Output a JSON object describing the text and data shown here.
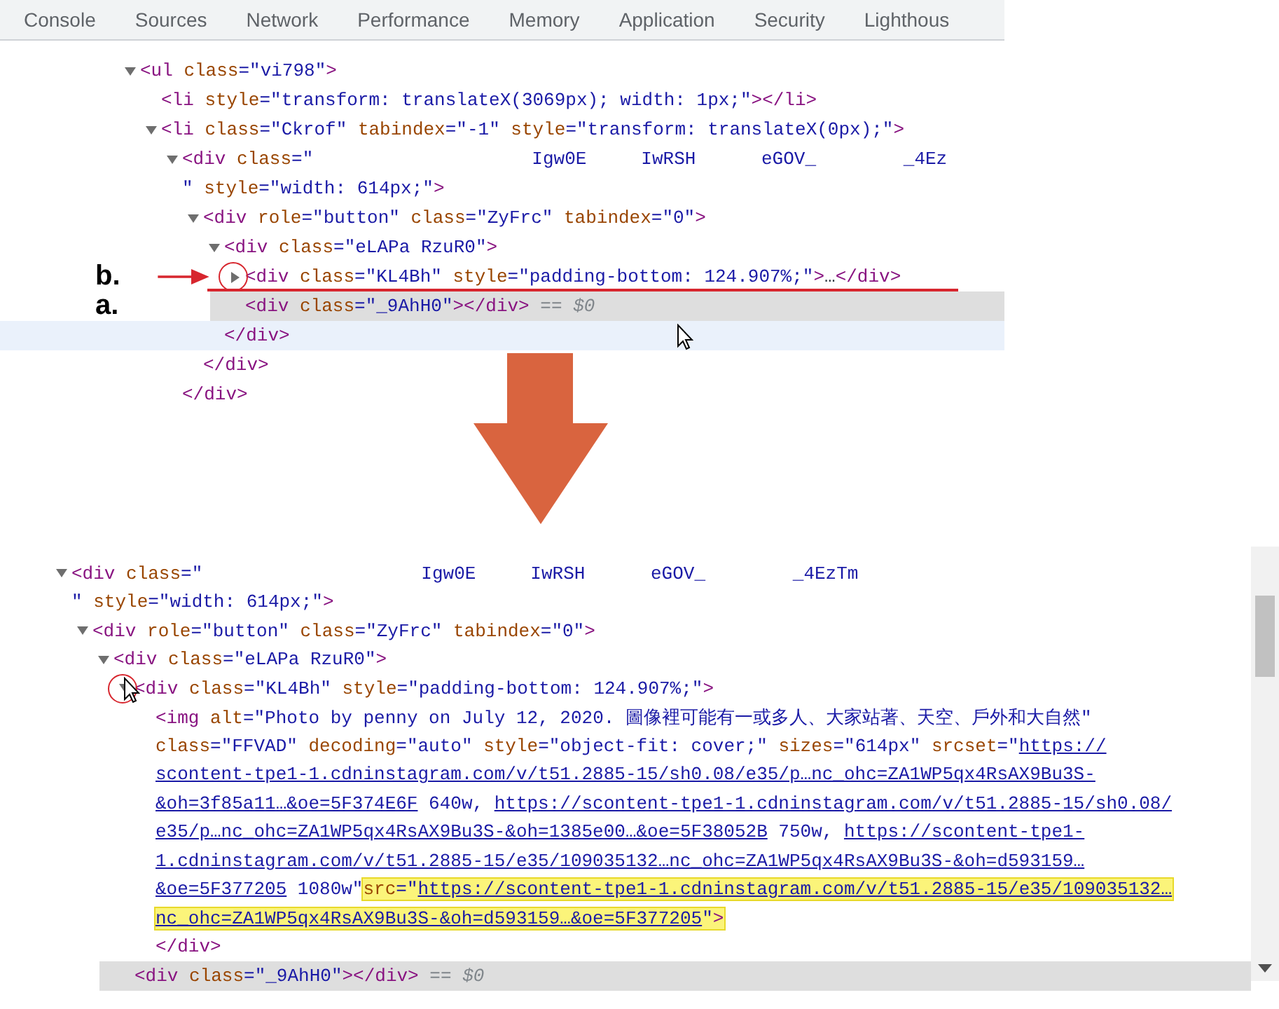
{
  "panels": [
    {
      "tabs": [
        {
          "label": "Console",
          "selected": false
        },
        {
          "label": "Sources",
          "selected": false
        },
        {
          "label": "Network",
          "selected": false
        },
        {
          "label": "Performance",
          "selected": false
        },
        {
          "label": "Memory",
          "selected": false
        },
        {
          "label": "Application",
          "selected": false
        },
        {
          "label": "Security",
          "selected": false
        },
        {
          "label": "Lighthous",
          "selected": false
        }
      ],
      "tree": [
        {
          "kind": "branch",
          "expanded": true,
          "selected": false,
          "hovered": false,
          "lines": [
            {
              "tokens": [
                {
                  "kind": "tag",
                  "text": "<ul"
                },
                {
                  "kind": "attr",
                  "text": " class"
                },
                {
                  "kind": "value",
                  "text": "=\"vi798\""
                },
                {
                  "kind": "tag",
                  "text": ">"
                }
              ]
            }
          ],
          "children": [
            {
              "kind": "leaf",
              "selected": false,
              "hovered": false,
              "lines": [
                {
                  "tokens": [
                    {
                      "kind": "tag",
                      "text": "<li"
                    },
                    {
                      "kind": "attr",
                      "text": " style"
                    },
                    {
                      "kind": "value",
                      "text": "=\"transform: translateX(3069px); width: 1px;\""
                    },
                    {
                      "kind": "tag",
                      "text": "></li>"
                    }
                  ]
                }
              ]
            },
            {
              "kind": "branch",
              "expanded": true,
              "selected": false,
              "hovered": false,
              "lines": [
                {
                  "tokens": [
                    {
                      "kind": "tag",
                      "text": "<li"
                    },
                    {
                      "kind": "attr",
                      "text": " class"
                    },
                    {
                      "kind": "value",
                      "text": "=\"Ckrof\""
                    },
                    {
                      "kind": "attr",
                      "text": " tabindex"
                    },
                    {
                      "kind": "value",
                      "text": "=\"-1\""
                    },
                    {
                      "kind": "attr",
                      "text": " style"
                    },
                    {
                      "kind": "value",
                      "text": "=\"transform: translateX(0px);\""
                    },
                    {
                      "kind": "tag",
                      "text": ">"
                    }
                  ]
                }
              ],
              "children": [
                {
                  "kind": "branch",
                  "expanded": true,
                  "selected": false,
                  "hovered": false,
                  "lines": [
                    {
                      "tokens": [
                        {
                          "kind": "tag",
                          "text": "<div"
                        },
                        {
                          "kind": "attr",
                          "text": " class"
                        },
                        {
                          "kind": "value",
                          "text": "=\"                    Igw0E     IwRSH      eGOV_        _4Ez"
                        }
                      ]
                    },
                    {
                      "tokens": [
                        {
                          "kind": "value",
                          "text": "\""
                        },
                        {
                          "kind": "attr",
                          "text": " style"
                        },
                        {
                          "kind": "value",
                          "text": "=\"width: 614px;\""
                        },
                        {
                          "kind": "tag",
                          "text": ">"
                        }
                      ]
                    }
                  ],
                  "children": [
                    {
                      "kind": "branch",
                      "expanded": true,
                      "selected": false,
                      "hovered": false,
                      "lines": [
                        {
                          "tokens": [
                            {
                              "kind": "tag",
                              "text": "<div"
                            },
                            {
                              "kind": "attr",
                              "text": " role"
                            },
                            {
                              "kind": "value",
                              "text": "=\"button\""
                            },
                            {
                              "kind": "attr",
                              "text": " class"
                            },
                            {
                              "kind": "value",
                              "text": "=\"ZyFrc\""
                            },
                            {
                              "kind": "attr",
                              "text": " tabindex"
                            },
                            {
                              "kind": "value",
                              "text": "=\"0\""
                            },
                            {
                              "kind": "tag",
                              "text": ">"
                            }
                          ]
                        }
                      ],
                      "children": [
                        {
                          "kind": "branch",
                          "expanded": true,
                          "selected": false,
                          "hovered": false,
                          "lines": [
                            {
                              "tokens": [
                                {
                                  "kind": "tag",
                                  "text": "<div"
                                },
                                {
                                  "kind": "attr",
                                  "text": " class"
                                },
                                {
                                  "kind": "value",
                                  "text": "=\"eLAPa RzuR0\""
                                },
                                {
                                  "kind": "tag",
                                  "text": ">"
                                }
                              ]
                            }
                          ],
                          "children": [
                            {
                              "kind": "branch",
                              "expanded": false,
                              "selected": false,
                              "hovered": false,
                              "annotation": {
                                "label": "b.",
                                "arrow": true,
                                "circled": true,
                                "underlined": true
                              },
                              "lines": [
                                {
                                  "tokens": [
                                    {
                                      "kind": "tag",
                                      "text": "<div"
                                    },
                                    {
                                      "kind": "attr",
                                      "text": " class"
                                    },
                                    {
                                      "kind": "value",
                                      "text": "=\"KL4Bh\""
                                    },
                                    {
                                      "kind": "attr",
                                      "text": " style"
                                    },
                                    {
                                      "kind": "value",
                                      "text": "=\"padding-bottom: 124.907%;\""
                                    },
                                    {
                                      "kind": "tag",
                                      "text": ">"
                                    },
                                    {
                                      "kind": "plain",
                                      "text": "…"
                                    },
                                    {
                                      "kind": "tag",
                                      "text": "</div>"
                                    }
                                  ]
                                }
                              ]
                            },
                            {
                              "kind": "leaf",
                              "selected": true,
                              "hovered": false,
                              "annotation": {
                                "label": "a."
                              },
                              "lines": [
                                {
                                  "tokens": [
                                    {
                                      "kind": "tag",
                                      "text": "<div"
                                    },
                                    {
                                      "kind": "attr",
                                      "text": " class"
                                    },
                                    {
                                      "kind": "value",
                                      "text": "=\"_9AhH0\""
                                    },
                                    {
                                      "kind": "tag",
                                      "text": "></div>"
                                    },
                                    {
                                      "kind": "dim",
                                      "text": " == *$0*"
                                    }
                                  ]
                                }
                              ]
                            }
                          ]
                        },
                        {
                          "kind": "leaf",
                          "selected": false,
                          "hovered": true,
                          "pointer": true,
                          "lines": [
                            {
                              "tokens": [
                                {
                                  "kind": "tag",
                                  "text": "</div>"
                                }
                              ]
                            }
                          ]
                        }
                      ]
                    },
                    {
                      "kind": "leaf",
                      "selected": false,
                      "hovered": false,
                      "lines": [
                        {
                          "tokens": [
                            {
                              "kind": "tag",
                              "text": "</div>"
                            }
                          ]
                        }
                      ]
                    }
                  ]
                },
                {
                  "kind": "leaf",
                  "selected": false,
                  "hovered": false,
                  "lines": [
                    {
                      "tokens": [
                        {
                          "kind": "tag",
                          "text": "</div>"
                        }
                      ]
                    }
                  ]
                }
              ]
            }
          ]
        }
      ]
    },
    {
      "tree": [
        {
          "kind": "branch",
          "expanded": true,
          "selected": false,
          "hovered": false,
          "lines": [
            {
              "tokens": [
                {
                  "kind": "tag",
                  "text": "<div"
                },
                {
                  "kind": "attr",
                  "text": " class"
                },
                {
                  "kind": "value",
                  "text": "=\"                    Igw0E     IwRSH      eGOV_        _4EzTm"
                }
              ]
            },
            {
              "tokens": [
                {
                  "kind": "value",
                  "text": "\""
                },
                {
                  "kind": "attr",
                  "text": " style"
                },
                {
                  "kind": "value",
                  "text": "=\"width: 614px;\""
                },
                {
                  "kind": "tag",
                  "text": ">"
                }
              ]
            }
          ],
          "children": [
            {
              "kind": "branch",
              "expanded": true,
              "selected": false,
              "hovered": false,
              "lines": [
                {
                  "tokens": [
                    {
                      "kind": "tag",
                      "text": "<div"
                    },
                    {
                      "kind": "attr",
                      "text": " role"
                    },
                    {
                      "kind": "value",
                      "text": "=\"button\""
                    },
                    {
                      "kind": "attr",
                      "text": " class"
                    },
                    {
                      "kind": "value",
                      "text": "=\"ZyFrc\""
                    },
                    {
                      "kind": "attr",
                      "text": " tabindex"
                    },
                    {
                      "kind": "value",
                      "text": "=\"0\""
                    },
                    {
                      "kind": "tag",
                      "text": ">"
                    }
                  ]
                }
              ],
              "children": [
                {
                  "kind": "branch",
                  "expanded": true,
                  "selected": false,
                  "hovered": false,
                  "lines": [
                    {
                      "tokens": [
                        {
                          "kind": "tag",
                          "text": "<div"
                        },
                        {
                          "kind": "attr",
                          "text": " class"
                        },
                        {
                          "kind": "value",
                          "text": "=\"eLAPa RzuR0\""
                        },
                        {
                          "kind": "tag",
                          "text": ">"
                        }
                      ]
                    }
                  ],
                  "children": [
                    {
                      "kind": "branch",
                      "expanded": true,
                      "selected": false,
                      "hovered": false,
                      "pointer": true,
                      "annotation": {
                        "circled": true
                      },
                      "lines": [
                        {
                          "tokens": [
                            {
                              "kind": "tag",
                              "text": "<div"
                            },
                            {
                              "kind": "attr",
                              "text": " class"
                            },
                            {
                              "kind": "value",
                              "text": "=\"KL4Bh\""
                            },
                            {
                              "kind": "attr",
                              "text": " style"
                            },
                            {
                              "kind": "value",
                              "text": "=\"padding-bottom: 124.907%;\""
                            },
                            {
                              "kind": "tag",
                              "text": ">"
                            }
                          ]
                        }
                      ],
                      "children": [
                        {
                          "kind": "leaf",
                          "selected": false,
                          "hovered": false,
                          "lines": [
                            {
                              "tokens": [
                                {
                                  "kind": "tag",
                                  "text": "<img"
                                },
                                {
                                  "kind": "attr",
                                  "text": " alt"
                                },
                                {
                                  "kind": "value",
                                  "text": "=\"Photo by penny on July 12, 2020. 圖像裡可能有一或多人、大家站著、天空、戶外和大自然\""
                                }
                              ]
                            },
                            {
                              "tokens": [
                                {
                                  "kind": "attr",
                                  "text": "class"
                                },
                                {
                                  "kind": "value",
                                  "text": "=\"FFVAD\""
                                },
                                {
                                  "kind": "attr",
                                  "text": " decoding"
                                },
                                {
                                  "kind": "value",
                                  "text": "=\"auto\""
                                },
                                {
                                  "kind": "attr",
                                  "text": " style"
                                },
                                {
                                  "kind": "value",
                                  "text": "=\"object-fit: cover;\""
                                },
                                {
                                  "kind": "attr",
                                  "text": " sizes"
                                },
                                {
                                  "kind": "value",
                                  "text": "=\"614px\""
                                },
                                {
                                  "kind": "attr",
                                  "text": " srcset"
                                },
                                {
                                  "kind": "value",
                                  "text": "=\""
                                },
                                {
                                  "kind": "link",
                                  "text": "https://"
                                }
                              ]
                            },
                            {
                              "tokens": [
                                {
                                  "kind": "link",
                                  "text": "scontent-tpe1-1.cdninstagram.com/v/t51.2885-15/sh0.08/e35/p…nc_ohc=ZA1WP5qx4RsAX9Bu3S-"
                                }
                              ]
                            },
                            {
                              "tokens": [
                                {
                                  "kind": "link",
                                  "text": "&oh=3f85a11…&oe=5F374E6F"
                                },
                                {
                                  "kind": "value",
                                  "text": " 640w, "
                                },
                                {
                                  "kind": "link",
                                  "text": "https://scontent-tpe1-1.cdninstagram.com/v/t51.2885-15/sh0.08/"
                                }
                              ]
                            },
                            {
                              "tokens": [
                                {
                                  "kind": "link",
                                  "text": "e35/p…nc_ohc=ZA1WP5qx4RsAX9Bu3S-&oh=1385e00…&oe=5F38052B"
                                },
                                {
                                  "kind": "value",
                                  "text": " 750w, "
                                },
                                {
                                  "kind": "link",
                                  "text": "https://scontent-tpe1-"
                                }
                              ]
                            },
                            {
                              "tokens": [
                                {
                                  "kind": "link",
                                  "text": "1.cdninstagram.com/v/t51.2885-15/e35/109035132…nc_ohc=ZA1WP5qx4RsAX9Bu3S-&oh=d593159…"
                                }
                              ]
                            },
                            {
                              "tokens": [
                                {
                                  "kind": "link",
                                  "text": "&oe=5F377205"
                                },
                                {
                                  "kind": "value",
                                  "text": " 1080w\""
                                }
                              ],
                              "highlighted": [
                                {
                                  "kind": "attr",
                                  "text": "src"
                                },
                                {
                                  "kind": "value",
                                  "text": "=\""
                                },
                                {
                                  "kind": "link",
                                  "text": "https://scontent-tpe1-1.cdninstagram.com/v/t51.2885-15/e35/109035132…"
                                }
                              ]
                            },
                            {
                              "highlighted": [
                                {
                                  "kind": "link",
                                  "text": "nc_ohc=ZA1WP5qx4RsAX9Bu3S-&oh=d593159…&oe=5F377205"
                                },
                                {
                                  "kind": "value",
                                  "text": "\""
                                },
                                {
                                  "kind": "tag",
                                  "text": ">"
                                }
                              ]
                            }
                          ]
                        },
                        {
                          "kind": "leaf",
                          "selected": false,
                          "hovered": false,
                          "lines": [
                            {
                              "tokens": [
                                {
                                  "kind": "tag",
                                  "text": "</div>"
                                }
                              ]
                            }
                          ]
                        }
                      ]
                    },
                    {
                      "kind": "leaf",
                      "selected": true,
                      "hovered": false,
                      "lines": [
                        {
                          "tokens": [
                            {
                              "kind": "tag",
                              "text": "<div"
                            },
                            {
                              "kind": "attr",
                              "text": " class"
                            },
                            {
                              "kind": "value",
                              "text": "=\"_9AhH0\""
                            },
                            {
                              "kind": "tag",
                              "text": "></div>"
                            },
                            {
                              "kind": "dim",
                              "text": " == *$0*"
                            }
                          ]
                        }
                      ]
                    }
                  ]
                }
              ]
            }
          ]
        }
      ]
    }
  ]
}
